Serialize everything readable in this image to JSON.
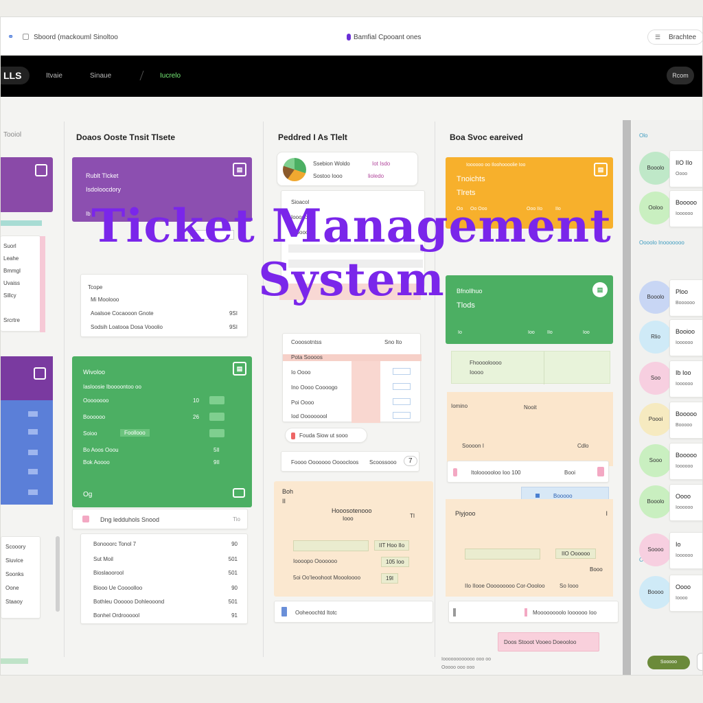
{
  "topbar": {
    "left_title": "Sboord (mackouml Sinoltoo",
    "center_title": "Bamfial Cpooant ones",
    "right_button": "Brachtee"
  },
  "navbar": {
    "logo": "LLS",
    "items": [
      "Itvaie",
      "Sinaue",
      "Iucrelo"
    ],
    "right_button": "Rcom"
  },
  "overlay_title": {
    "line1": "Ticket Management",
    "line2": "System"
  },
  "left_stub": {
    "header": "Tooiol",
    "list_top": [
      "Suorl",
      "Leahe",
      "Bmmgl",
      "Uvaiss",
      "Sillcy",
      "Srcrtre"
    ],
    "list_bottom": [
      "Scooory",
      "Siuvice",
      "Soonks",
      "Oone",
      "Staaoy"
    ]
  },
  "col1": {
    "title": "Doaos Ooste Tnsit Tlsete",
    "purple_card": {
      "line1": "Rublt Tlcket",
      "line2": "Isdoloocdory",
      "foot_left": "Ib"
    },
    "list1": [
      {
        "label": "Tcope",
        "value": ""
      },
      {
        "label": "Mi Moolooo",
        "value": ""
      },
      {
        "label": "Aoalsoe Cocaooon Gnote",
        "value": "9SI"
      },
      {
        "label": "Sodsih Loatooa Dosa Vooolio",
        "value": "9SI"
      }
    ],
    "green_card": {
      "title": "Wivoloo",
      "sub": "Iasloosie Iboooontoo oo",
      "rows": [
        {
          "label": "Oooooooo",
          "value": "10"
        },
        {
          "label": "Boooooo",
          "value": "26"
        },
        {
          "label": "Soioo",
          "tag": "Foollooo",
          "value": ""
        },
        {
          "label": "Bo Aoos Ooou",
          "value": "5lI"
        },
        {
          "label": "Bok Aoooo",
          "value": "9II"
        }
      ],
      "foot": "Og"
    },
    "below_green": {
      "label": "Dng ledduhols Snood",
      "value": "Tio"
    },
    "list2": [
      {
        "label": "Bonooorc Tonol 7",
        "value": "90"
      },
      {
        "label": "Sut Moil",
        "value": "501"
      },
      {
        "label": "Bioslaoorool",
        "value": "501"
      },
      {
        "label": "Biooo Ue Coooolloo",
        "value": "90"
      },
      {
        "label": "Bothleu Oooooo Dohleooond",
        "value": "501"
      },
      {
        "label": "Bonhel Ordroooool",
        "value": "91"
      }
    ]
  },
  "col2": {
    "title": "Peddred I As Tlelt",
    "popup": {
      "line1": "Ssebion Woldo",
      "tag1": "Iot Isdo",
      "line2": "Sostoo Iooo",
      "tag2": "lioledo"
    },
    "list": [
      "Sioacol",
      "Iooosoo",
      "Stooool"
    ],
    "table_head": [
      "Cooosotntss",
      "Sno Ito"
    ],
    "table_rows": [
      {
        "label": "Pota Soooos",
        "value": ""
      },
      {
        "label": "Io Oooo",
        "value": ""
      },
      {
        "label": "Ino Oooo Coooogo",
        "value": ""
      },
      {
        "label": "Poi Oooo",
        "value": ""
      },
      {
        "label": "Iod Ooooooool",
        "value": ""
      }
    ],
    "pill": "Fouda Siow ut sooo",
    "summary": {
      "label": "Foooo Ooooooo Oooocloos",
      "extra": "Scoossooo",
      "value": "7"
    },
    "peach": {
      "head": "Boh",
      "sub": "II",
      "title": "Hooosotenooo",
      "sub2": "Iooo",
      "value": "TI",
      "rows": [
        {
          "label": "",
          "value": "IIT Hoo IIo"
        },
        {
          "label": "Ioooopo Ooooooo",
          "value": "105 Ioo"
        },
        {
          "label": "5oi Oo'Ieoohoot Moooloooo",
          "value": "19I"
        }
      ]
    },
    "foot": "Ooheoochtd Itotc"
  },
  "col3": {
    "title": "Boa Svoc eareived",
    "orange_card": {
      "small": "Ioooooo oo Iloohoooolie Ioo",
      "line1": "Tnoichts",
      "line2": "Tlrets",
      "foot": [
        "Oo",
        "Oo Ooo",
        "Ooo IIo",
        "IIo"
      ]
    },
    "green_card": {
      "line1": "Bfnollhuo",
      "line2": "Tlods",
      "foot": [
        "Io",
        "Ioo",
        "IIo",
        "Ioo"
      ]
    },
    "mint": {
      "label": "Fhooooloooo",
      "sub": "Ioooo"
    },
    "cream": {
      "left": "Iomino",
      "right": "Nooit",
      "foot_left": "Soooon I",
      "foot_right": "Cdlo"
    },
    "pink_bar": {
      "label": "Itoloooooloo Ioo 100",
      "value": "Booi"
    },
    "blue_chip": "Booooo",
    "peach": {
      "title": "Piyjooo",
      "rows": [
        {
          "label": "",
          "value": "IIO Oooooo"
        },
        {
          "label": "",
          "value": "Booo"
        },
        {
          "label": "IIo IIooe Ooooooooo Cor-Oooloo",
          "value": "So Iooo"
        }
      ]
    },
    "foot": "Moooooooolo Ioooooo Ioo",
    "pink_button": "Doos Stooot Vooeo Doeooloo"
  },
  "right_panel": {
    "sec1": "Olo",
    "sec2": "Oooolo Inooooooo",
    "sec3": "Ooooo",
    "rows": [
      {
        "circle": "Booolo",
        "title": "IIO IIo",
        "sub": "Oooo",
        "color": "#bfe8c8"
      },
      {
        "circle": "Ooloo",
        "title": "Booooo",
        "sub": "Ioooooo",
        "color": "#c9efc0"
      },
      {
        "circle": "Booolo",
        "title": "Ploo",
        "sub": "Boooooo",
        "color": "#c8d6f4"
      },
      {
        "circle": "Rlio",
        "title": "Booioo",
        "sub": "Ioooooo",
        "color": "#cfeaf7"
      },
      {
        "circle": "Soo",
        "title": "Ib Ioo",
        "sub": "Ioooooo",
        "color": "#f7cfe0"
      },
      {
        "circle": "Poooi",
        "title": "Booooo",
        "sub": "Booooo",
        "color": "#f6eac0"
      },
      {
        "circle": "Sooo",
        "title": "Booooo",
        "sub": "Ioooooo",
        "color": "#c9efc0"
      },
      {
        "circle": "Booolo",
        "title": "Oooo",
        "sub": "Ioooooo",
        "color": "#c9efc0"
      },
      {
        "circle": "Soooo",
        "title": "Io",
        "sub": "Ioooooo",
        "color": "#f7cfe0"
      },
      {
        "circle": "Boooo",
        "title": "Oooo",
        "sub": "Ioooo",
        "color": "#cfeaf7"
      }
    ]
  },
  "footer": {
    "text1": "Ioooooooooooo ooo oo",
    "text2": "Ooooo ooo ooo",
    "button": "Sooooo"
  }
}
